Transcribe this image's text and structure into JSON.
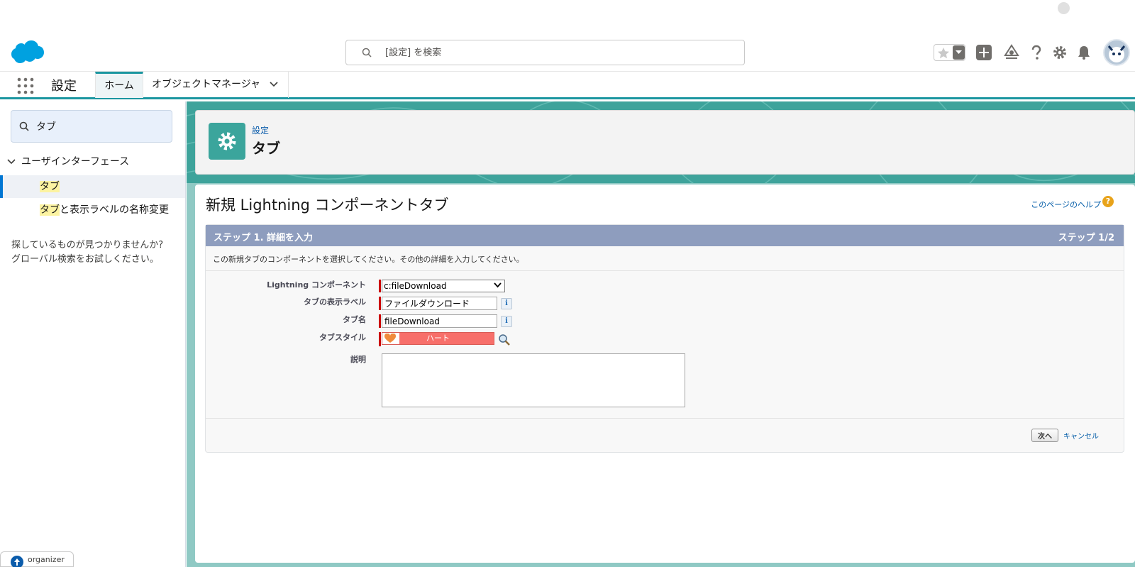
{
  "header": {
    "search_placeholder": "[設定] を検索"
  },
  "nav": {
    "app_name": "設定",
    "tabs": [
      {
        "label": "ホーム"
      },
      {
        "label": "オブジェクトマネージャ"
      }
    ]
  },
  "sidebar": {
    "quickfind_value": "タブ",
    "tree_parent": "ユーザインターフェース",
    "items": [
      {
        "highlight": "タブ",
        "rest": ""
      },
      {
        "highlight": "タブ",
        "rest": "と表示ラベルの名称変更"
      }
    ],
    "not_found_line1": "探しているものが見つかりませんか?",
    "not_found_line2": "グローバル検索をお試しください。",
    "organizer_label": "organizer"
  },
  "page_header": {
    "breadcrumb": "設定",
    "title": "タブ"
  },
  "content": {
    "title": "新規 Lightning コンポーネントタブ",
    "help_link": "このページのヘルプ",
    "step_title": "ステップ 1. 詳細を入力",
    "step_counter": "ステップ 1/2",
    "step_description": "この新規タブのコンポーネントを選択してください。その他の詳細を入力してください。",
    "fields": {
      "component_label": "Lightning コンポーネント",
      "component_value": "c:fileDownload",
      "display_label_label": "タブの表示ラベル",
      "display_label_value": "ファイルダウンロード",
      "tab_name_label": "タブ名",
      "tab_name_value": "fileDownload",
      "tab_style_label": "タブスタイル",
      "tab_style_value": "ハート",
      "description_label": "説明"
    },
    "buttons": {
      "next": "次へ",
      "cancel": "キャンセル"
    }
  },
  "colors": {
    "accent": "#1b96a0",
    "brand_blue": "#00a1e0",
    "step_header": "#8e9dbe",
    "tab_style": "#f76f6a"
  }
}
